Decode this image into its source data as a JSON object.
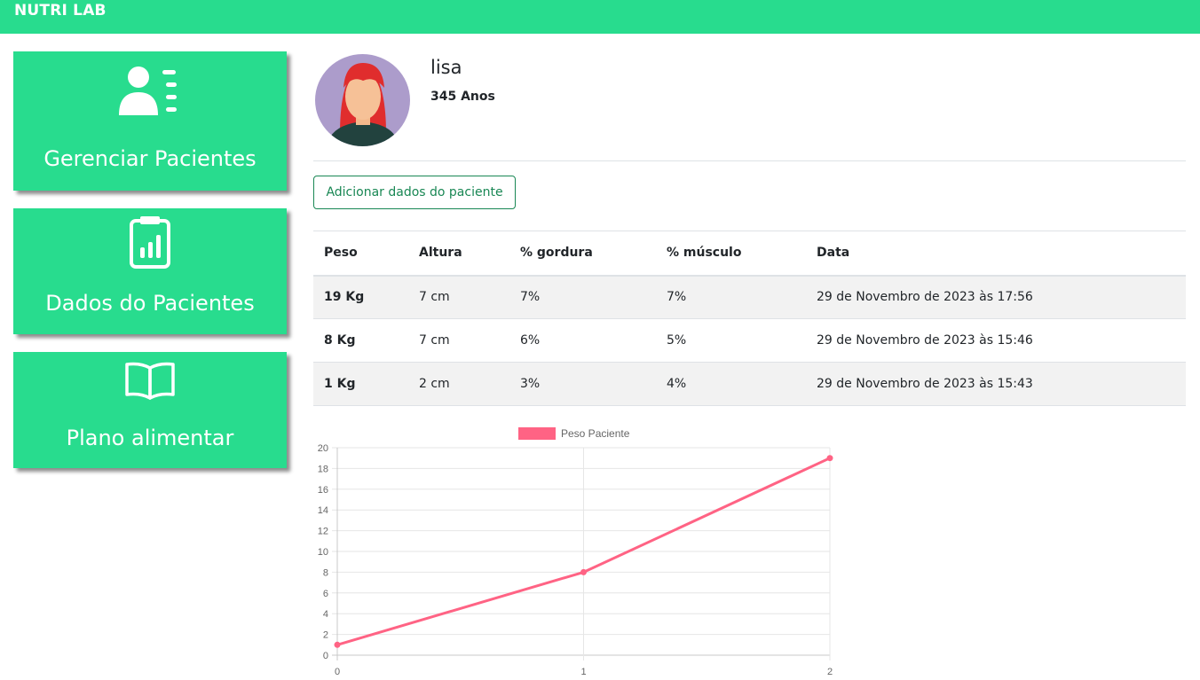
{
  "brand": "NUTRI LAB",
  "nav": {
    "manage_patients": "Gerenciar Pacientes",
    "patient_data": "Dados do Pacientes",
    "meal_plan": "Plano alimentar"
  },
  "patient": {
    "name": "lisa",
    "age": "345 Anos"
  },
  "add_button": "Adicionar dados do paciente",
  "table": {
    "headers": [
      "Peso",
      "Altura",
      "% gordura",
      "% músculo",
      "Data"
    ],
    "rows": [
      [
        "19 Kg",
        "7 cm",
        "7%",
        "7%",
        "29 de Novembro de 2023 às 17:56"
      ],
      [
        "8 Kg",
        "7 cm",
        "6%",
        "5%",
        "29 de Novembro de 2023 às 15:46"
      ],
      [
        "1 Kg",
        "2 cm",
        "3%",
        "4%",
        "29 de Novembro de 2023 às 15:43"
      ]
    ]
  },
  "colors": {
    "brand_green": "#28dc8e",
    "button_green": "#198754",
    "series_line": "#ff6384"
  },
  "chart_data": {
    "type": "line",
    "x": [
      0,
      1,
      2
    ],
    "series": [
      {
        "name": "Peso Paciente",
        "values": [
          1,
          8,
          19
        ]
      }
    ],
    "ylim": [
      0,
      20
    ],
    "yticks": [
      0,
      2,
      4,
      6,
      8,
      10,
      12,
      14,
      16,
      18,
      20
    ],
    "xticks": [
      0,
      1,
      2
    ],
    "legend": "top",
    "grid": true
  }
}
